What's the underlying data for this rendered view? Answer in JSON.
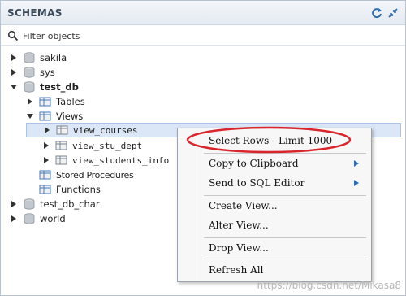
{
  "header": {
    "title": "SCHEMAS",
    "icons": [
      "refresh-icon",
      "collapse-icon"
    ]
  },
  "filter": {
    "placeholder": "Filter objects",
    "value": ""
  },
  "tree": {
    "sakila": "sakila",
    "sys": "sys",
    "test_db": "test_db",
    "tables": "Tables",
    "views": "Views",
    "view_courses": "view_courses",
    "view_stu_dept": "view_stu_dept",
    "view_students_info": "view_students_info",
    "stored_procedures": "Stored Procedures",
    "functions": "Functions",
    "test_db_char": "test_db_char",
    "world": "world"
  },
  "context_menu": {
    "select_rows": "Select Rows - Limit 1000",
    "copy_to_clipboard": "Copy to Clipboard",
    "send_to_sql_editor": "Send to SQL Editor",
    "create_view": "Create View...",
    "alter_view": "Alter View...",
    "drop_view": "Drop View...",
    "refresh_all": "Refresh All"
  },
  "watermark": "https://blog.csdn.net/Mikasa8",
  "colors": {
    "accent_blue": "#2f6db3",
    "highlight_red": "#d9262c",
    "selection_bg": "#dbe7f7",
    "folder_blue": "#4a79b8",
    "db_grey": "#b9bec5"
  }
}
